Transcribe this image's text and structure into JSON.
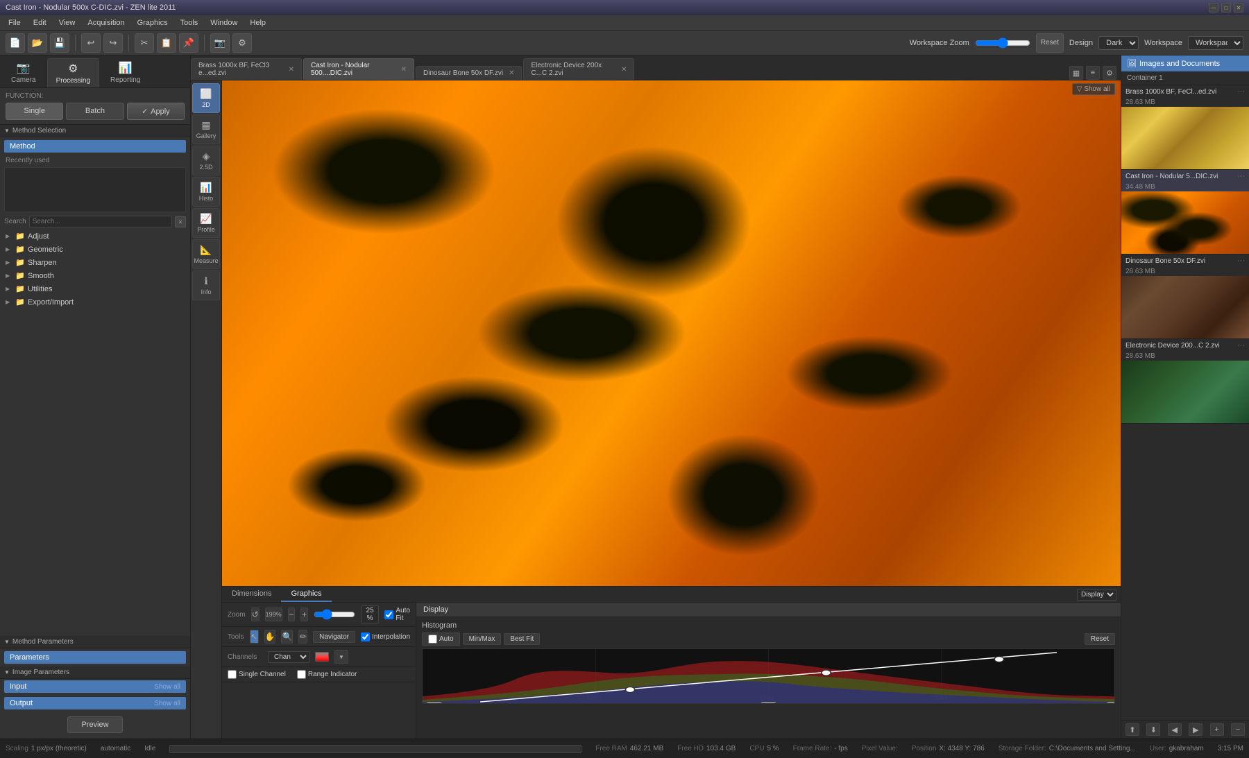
{
  "window": {
    "title": "Cast Iron - Nodular 500x C-DIC.zvi - ZEN lite 2011"
  },
  "menubar": {
    "items": [
      "File",
      "Edit",
      "View",
      "Acquisition",
      "Graphics",
      "Tools",
      "Window",
      "Help"
    ]
  },
  "toolbar": {
    "workspace_zoom_label": "Workspace Zoom",
    "design_label": "Design",
    "theme_options": [
      "Dark"
    ],
    "workspace_label": "Workspace",
    "reset_label": "Reset"
  },
  "left_panel": {
    "tabs": [
      {
        "id": "camera",
        "label": "Camera",
        "icon": "📷"
      },
      {
        "id": "processing",
        "label": "Processing",
        "icon": "⚙"
      },
      {
        "id": "reporting",
        "label": "Reporting",
        "icon": "📊"
      }
    ],
    "active_tab": "processing",
    "function_label": "Function:",
    "single_label": "Single",
    "batch_label": "Batch",
    "apply_label": "Apply",
    "method_section": "Method Selection",
    "method_selected": "Method",
    "recently_used_label": "Recently used",
    "search_label": "Search",
    "search_clear_label": "×",
    "tree_items": [
      {
        "label": "Adjust",
        "icon": "📁",
        "expandable": true
      },
      {
        "label": "Geometric",
        "icon": "📁",
        "expandable": true
      },
      {
        "label": "Sharpen",
        "icon": "📁",
        "expandable": true
      },
      {
        "label": "Smooth",
        "icon": "📁",
        "expandable": true
      },
      {
        "label": "Utilities",
        "icon": "📁",
        "expandable": true
      },
      {
        "label": "Export/Import",
        "icon": "📁",
        "expandable": true
      }
    ],
    "method_params_section": "Method Parameters",
    "params_selected": "Parameters",
    "image_params_section": "Image Parameters",
    "input_label": "Input",
    "output_label": "Output",
    "show_all_label": "Show all",
    "preview_label": "Preview"
  },
  "tabs": [
    {
      "label": "Brass 1000x BF, FeCl3 e...ed.zvi",
      "active": false,
      "closeable": true
    },
    {
      "label": "Cast Iron - Nodular 500...DIC.zvi",
      "active": true,
      "closeable": true
    },
    {
      "label": "Dinosaur Bone 50x DF.zvi",
      "active": false,
      "closeable": true
    },
    {
      "label": "Electronic Device 200x C...C 2.zvi",
      "active": false,
      "closeable": true
    }
  ],
  "view_sidebar": {
    "items": [
      {
        "id": "2d",
        "label": "2D",
        "icon": "⬜",
        "active": true
      },
      {
        "id": "gallery",
        "label": "Gallery",
        "icon": "▦"
      },
      {
        "id": "25d",
        "label": "2.5D",
        "icon": "◈"
      },
      {
        "id": "histo",
        "label": "Histo",
        "icon": "📊"
      },
      {
        "id": "profile",
        "label": "Profile",
        "icon": "📈"
      },
      {
        "id": "measure",
        "label": "Measure",
        "icon": "📐"
      },
      {
        "id": "info",
        "label": "Info",
        "icon": "ℹ"
      }
    ]
  },
  "bottom_tabs": [
    {
      "label": "Dimensions",
      "active": false
    },
    {
      "label": "Graphics",
      "active": true
    }
  ],
  "zoom_tools": {
    "zoom_label": "Zoom",
    "zoom_value": "199%",
    "zoom_percent": "25 %",
    "auto_fit_label": "Auto Fit",
    "tools_label": "Tools",
    "navigator_label": "Navigator",
    "interpolation_label": "Interpolation"
  },
  "channels": {
    "label": "Channels",
    "selected": "Chan",
    "single_channel_label": "Single Channel",
    "range_indicator_label": "Range Indicator"
  },
  "display": {
    "header": "Display",
    "histogram_label": "Histogram",
    "auto_label": "Auto",
    "minmax_label": "Min/Max",
    "best_fit_label": "Best Fit",
    "reset_label": "Reset",
    "histogram_data": {
      "x_max": 255,
      "channels": [
        "red",
        "green",
        "blue"
      ]
    }
  },
  "right_panel": {
    "header": "Images and Documents",
    "header_icon": "🖼",
    "container_label": "Container 1",
    "documents": [
      {
        "name": "Brass 1000x BF, FeCl...ed.zvi",
        "size": "28.63 MB",
        "thumb_class": "thumb-brass",
        "active": false
      },
      {
        "name": "Cast Iron - Nodular 5...DIC.zvi",
        "size": "34.48 MB",
        "thumb_class": "thumb-castiron",
        "active": true
      },
      {
        "name": "Dinosaur Bone 50x DF.zvi",
        "size": "28.63 MB",
        "thumb_class": "thumb-dinosaur",
        "active": false
      },
      {
        "name": "Electronic Device 200...C 2.zvi",
        "size": "28.63 MB",
        "thumb_class": "thumb-electronic",
        "active": false
      }
    ]
  },
  "statusbar": {
    "scaling_label": "Scaling",
    "scaling_value": "1 px/px (theoretic)",
    "scaling_auto": "automatic",
    "idle_label": "Idle",
    "progress": "0%",
    "ram_label": "Free RAM",
    "ram_value": "462.21 MB",
    "hd_label": "Free HD",
    "hd_value": "103.4 GB",
    "cpu_label": "CPU",
    "cpu_value": "5 %",
    "frame_label": "Frame Rate:",
    "frame_value": "- fps",
    "pixel_label": "Pixel Value:",
    "position_label": "Position",
    "position_value": "X: 4348  Y: 786",
    "storage_label": "Storage Folder:",
    "storage_value": "C:\\Documents and Setting...",
    "user_label": "User:",
    "user_value": "gkabraham",
    "time": "3:15 PM"
  }
}
